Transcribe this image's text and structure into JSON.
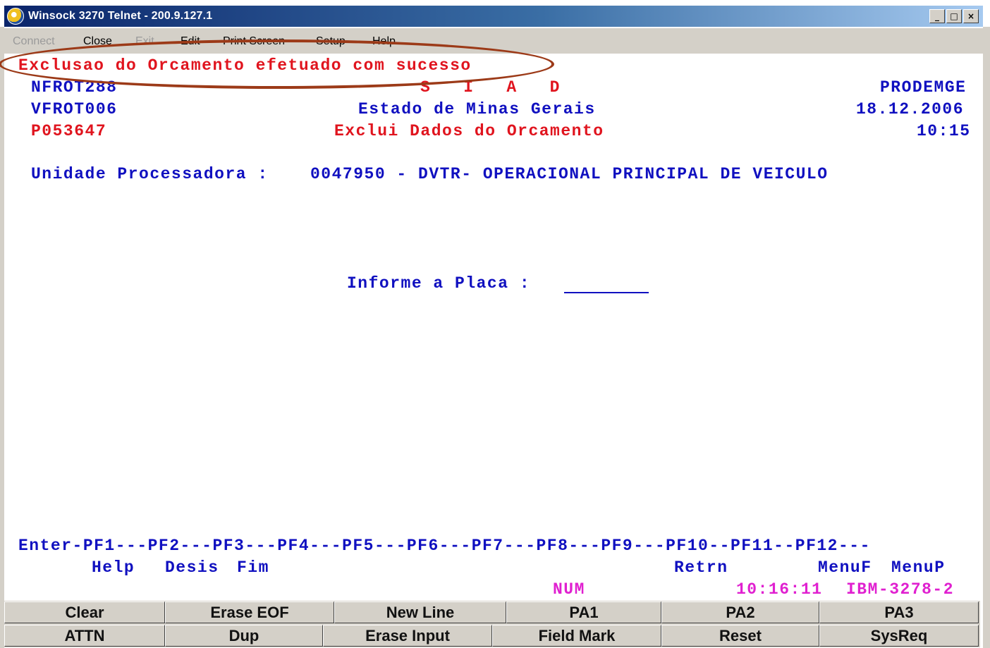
{
  "window": {
    "title": "Winsock 3270 Telnet - 200.9.127.1",
    "buttons": [
      "_",
      "□",
      "×"
    ]
  },
  "menu": [
    "Connect",
    "Close",
    "Exit",
    "Edit",
    "Print Screen",
    "Setup",
    "Help"
  ],
  "screen": {
    "message": "Exclusao do Orcamento efetuado com sucesso",
    "program_id": "NFROT288",
    "system_name": "S   I   A   D",
    "org": "PRODEMGE",
    "transaction_id": "VFROT006",
    "state": "Estado de Minas Gerais",
    "date": "18.12.2006",
    "user_id": "P053647",
    "screen_title": "Exclui Dados do Orcamento",
    "time": "10:15",
    "unit_label": "Unidade Processadora :",
    "unit_value": "0047950 - DVTR- OPERACIONAL PRINCIPAL DE VEICULO",
    "plate_label": "Informe a Placa :",
    "plate_value": "",
    "pf_keys_line": "Enter-PF1---PF2---PF3---PF4---PF5---PF6---PF7---PF8---PF9---PF10--PF11--PF12---",
    "pf_help": "Help",
    "pf_desis": "Desis",
    "pf_fim": "Fim",
    "pf_retrn": "Retrn",
    "pf_menuf": "MenuF",
    "pf_menup": "MenuP",
    "status_num": "NUM",
    "status_time": "10:16:11",
    "status_terminal": "IBM-3278-2"
  },
  "keypad": {
    "row1": [
      "Clear",
      "Erase EOF",
      "New Line",
      "PA1",
      "PA2",
      "PA3"
    ],
    "row2": [
      "ATTN",
      "Dup",
      "Erase Input",
      "Field Mark",
      "Reset",
      "SysReq"
    ]
  },
  "colors": {
    "message": "#e0141e",
    "field_text": "#1010c0",
    "status": "#e020d0",
    "annotation_oval": "#9c3a18"
  }
}
